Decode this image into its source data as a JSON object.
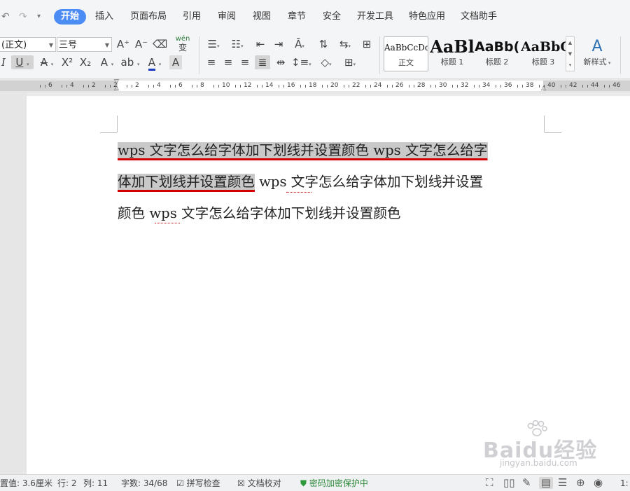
{
  "menu": {
    "undo_icon": "undo-arrow",
    "redo_icon": "redo-arrow",
    "tabs": [
      "开始",
      "插入",
      "页面布局",
      "引用",
      "审阅",
      "视图",
      "章节",
      "安全",
      "开发工具",
      "特色应用",
      "文档助手"
    ],
    "active_tab": "开始"
  },
  "ribbon": {
    "font_name": "(正文)",
    "font_size": "三号",
    "pinyin_label": "wén",
    "styles": [
      {
        "sample": "AaBbCcDd",
        "label": "正文"
      },
      {
        "sample": "AaBl",
        "label": "标题 1"
      },
      {
        "sample": "AaBb(",
        "label": "标题 2"
      },
      {
        "sample": "AaBbC",
        "label": "标题 3"
      }
    ],
    "new_style_label": "新样式"
  },
  "ruler": {
    "numbers": [
      "6",
      "4",
      "2",
      "2",
      "2",
      "4",
      "6",
      "8",
      "10",
      "12",
      "14",
      "16",
      "18",
      "20",
      "22",
      "24",
      "26",
      "28",
      "30",
      "32",
      "34",
      "36",
      "38",
      "40",
      "42",
      "44",
      "46"
    ]
  },
  "document": {
    "lines": [
      {
        "hl": "wps 文字怎么给字体加下划线并设置颜色 wps 文字怎么给字",
        "plain": ""
      },
      {
        "hl": "体加下划线并设置颜色",
        "plain": " wps 文字怎么给字体加下划线并设置"
      },
      {
        "hl": "",
        "plain": "颜色 wps 文字怎么给字体加下划线并设置颜色"
      }
    ]
  },
  "watermark": {
    "brand": "Baidu经验",
    "url": "jingyan.baidu.com"
  },
  "statusbar": {
    "setting_value": "置值: 3.6厘米",
    "row": "行: 2",
    "col": "列: 11",
    "word_count": "字数: 34/68",
    "spell_check": "拼写检查",
    "doc_proof": "文档校对",
    "encrypt": "密码加密保护中",
    "zoom": "1:"
  },
  "colors": {
    "accent": "#4b8cf5",
    "underline": "#d40000",
    "highlight": "#c9c9c9",
    "protect_green": "#2e9a3b"
  }
}
